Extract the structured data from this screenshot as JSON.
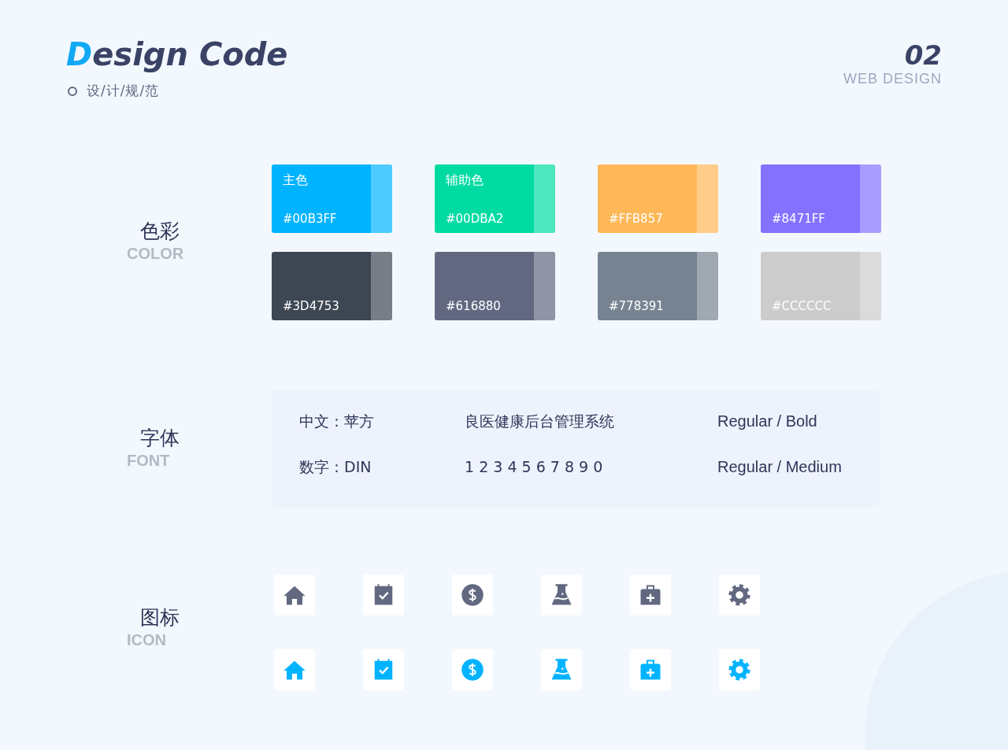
{
  "header": {
    "title_initial": "D",
    "title_rest": "esign Code",
    "subtitle": "设/计/规/范",
    "page_number": "02",
    "page_caption": "WEB DESIGN"
  },
  "sections": [
    {
      "label": "色彩",
      "label_en": "COLOR"
    },
    {
      "label": "字体",
      "label_en": "FONT"
    },
    {
      "label": "图标",
      "label_en": "ICON"
    }
  ],
  "colors": [
    {
      "name": "主色",
      "hex": "#00B3FF",
      "color": "#00b3ff"
    },
    {
      "name": "辅助色",
      "hex": "#00DBA2",
      "color": "#00dba2"
    },
    {
      "hex": "#FFB857",
      "color": "#ffb857"
    },
    {
      "hex": "#8471FF",
      "color": "#8471ff"
    },
    {
      "hex": "#3D4753",
      "color": "#3d4753"
    },
    {
      "hex": "#616880",
      "color": "#616880"
    },
    {
      "hex": "#778391",
      "color": "#778391"
    },
    {
      "hex": "#CCCCCC",
      "color": "#cccccc"
    }
  ],
  "fonts": [
    {
      "label": "中文：苹方",
      "sample": "良医健康后台管理系统",
      "weights": "Regular / Bold"
    },
    {
      "label": "数字：DIN",
      "sample": "1 2 3 4 5 6 7 8 9 0",
      "weights": "Regular / Medium"
    }
  ],
  "icon_rows": [
    {
      "color": "#616880",
      "icons": [
        {
          "kind": "home"
        },
        {
          "kind": "calendar"
        },
        {
          "kind": "dollar"
        },
        {
          "kind": "flask"
        },
        {
          "kind": "kit"
        },
        {
          "kind": "gear"
        }
      ]
    },
    {
      "color": "#00b3ff",
      "icons": [
        {
          "kind": "home"
        },
        {
          "kind": "calendar"
        },
        {
          "kind": "dollar"
        },
        {
          "kind": "flask"
        },
        {
          "kind": "kit"
        },
        {
          "kind": "gear"
        }
      ]
    }
  ]
}
